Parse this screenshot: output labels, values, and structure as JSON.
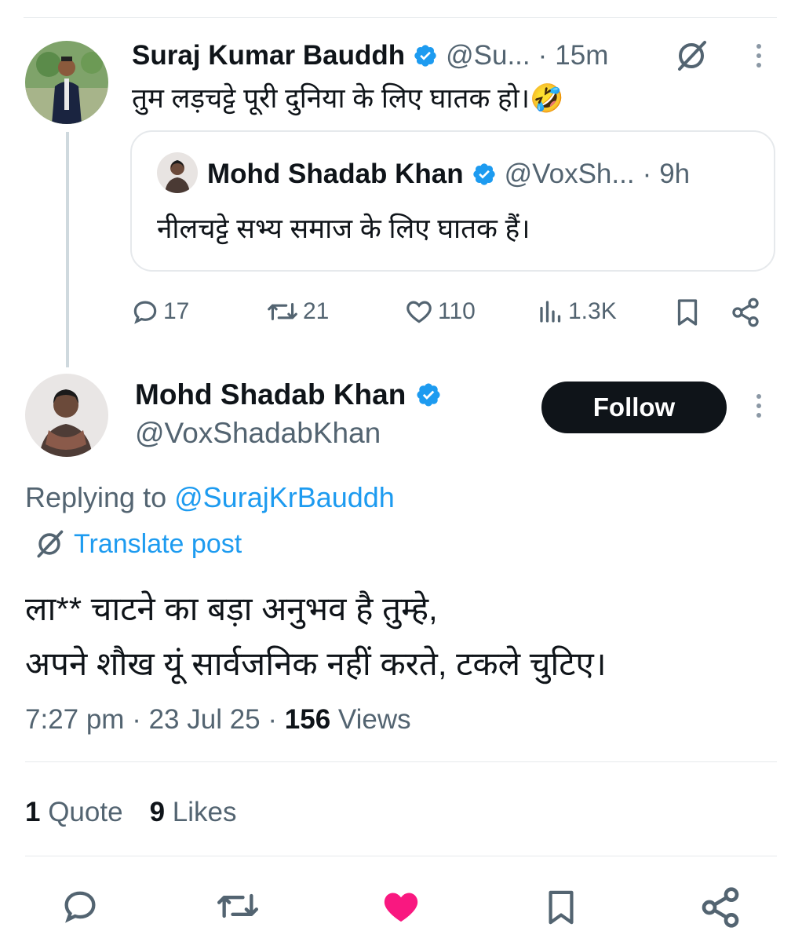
{
  "parent_tweet": {
    "author_name": "Suraj Kumar Bauddh",
    "handle": "@Su...",
    "dot": "·",
    "time": "15m",
    "text": "तुम लड़चट्टे पूरी दुनिया के लिए घातक हो।🤣",
    "quoted": {
      "author_name": "Mohd Shadab Khan",
      "handle": "@VoxSh...",
      "dot": "·",
      "time": "9h",
      "text": "नीलचट्टे सभ्य समाज के लिए घातक हैं।"
    },
    "actions": {
      "replies": "17",
      "reposts": "21",
      "likes": "110",
      "views": "1.3K"
    }
  },
  "main_tweet": {
    "author_name": "Mohd Shadab Khan",
    "handle": "@VoxShadabKhan",
    "follow_label": "Follow",
    "replying_prefix": "Replying to",
    "replying_handle": "@SurajKrBauddh",
    "translate_label": "Translate post",
    "text_line1": "ला** चाटने का बड़ा अनुभव है तुम्हे,",
    "text_line2": "अपने शौख यूं सार्वजनिक नहीं करते, टकले चुटिए।",
    "time": "7:27 pm",
    "date": "23 Jul 25",
    "dot": "·",
    "views_count": "156",
    "views_label": "Views",
    "quotes_count": "1",
    "quotes_label": "Quote",
    "likes_count": "9",
    "likes_label": "Likes"
  },
  "colors": {
    "accent": "#1d9bf0",
    "like_active": "#f91880",
    "muted": "#536471",
    "follow_bg": "#0f1419"
  },
  "icons": [
    "grok-icon",
    "more-icon",
    "verified-badge-icon",
    "reply-icon",
    "repost-icon",
    "like-icon",
    "views-icon",
    "bookmark-icon",
    "share-icon"
  ]
}
